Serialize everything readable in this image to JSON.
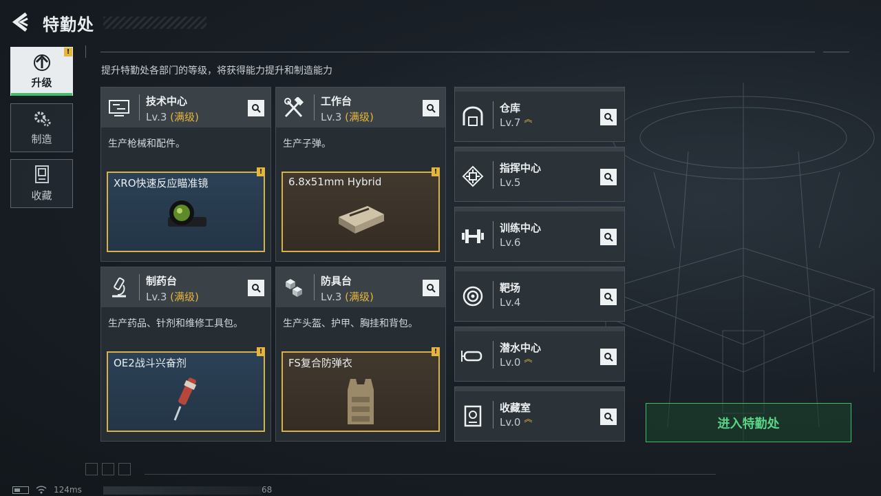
{
  "header": {
    "title": "特勤处",
    "subtitle": "提升特勤处各部门的等级，将获得能力提升和制造能力"
  },
  "sidebar": {
    "items": [
      {
        "label": "升级",
        "icon": "upgrade-icon",
        "active": true,
        "badge": "!"
      },
      {
        "label": "制造",
        "icon": "gears-icon",
        "active": false
      },
      {
        "label": "收藏",
        "icon": "collection-icon",
        "active": false
      }
    ]
  },
  "cards": [
    {
      "name": "技术中心",
      "level": "Lv.3",
      "max_label": "(满级)",
      "desc": "生产枪械和配件。",
      "item": "XRO快速反应瞄准镜",
      "badge": "!",
      "icon": "computer-icon"
    },
    {
      "name": "工作台",
      "level": "Lv.3",
      "max_label": "(满级)",
      "desc": "生产子弹。",
      "item": "6.8x51mm Hybrid",
      "badge": "!",
      "icon": "hammer-wrench-icon"
    },
    {
      "name": "制药台",
      "level": "Lv.3",
      "max_label": "(满级)",
      "desc": "生产药品、针剂和维修工具包。",
      "item": "OE2战斗兴奋剂",
      "badge": "!",
      "icon": "microscope-icon"
    },
    {
      "name": "防具台",
      "level": "Lv.3",
      "max_label": "(满级)",
      "desc": "生产头盔、护甲、胸挂和背包。",
      "item": "FS复合防弹衣",
      "badge": "!",
      "icon": "cubes-icon"
    }
  ],
  "facilities": [
    {
      "name": "仓库",
      "level": "Lv.7",
      "upgradable": true,
      "icon": "warehouse-icon"
    },
    {
      "name": "指挥中心",
      "level": "Lv.5",
      "upgradable": false,
      "icon": "chip-icon"
    },
    {
      "name": "训练中心",
      "level": "Lv.6",
      "upgradable": false,
      "icon": "dumbbell-icon"
    },
    {
      "name": "靶场",
      "level": "Lv.4",
      "upgradable": false,
      "icon": "target-icon"
    },
    {
      "name": "潜水中心",
      "level": "Lv.0",
      "upgradable": true,
      "icon": "goggles-icon"
    },
    {
      "name": "收藏室",
      "level": "Lv.0",
      "upgradable": true,
      "icon": "vault-icon"
    }
  ],
  "enter_button": {
    "label": "进入特勤处"
  },
  "status": {
    "ping": "124ms",
    "fps": "68"
  },
  "colors": {
    "accent_green": "#3fbf6a",
    "max_gold": "#e6b53c"
  }
}
